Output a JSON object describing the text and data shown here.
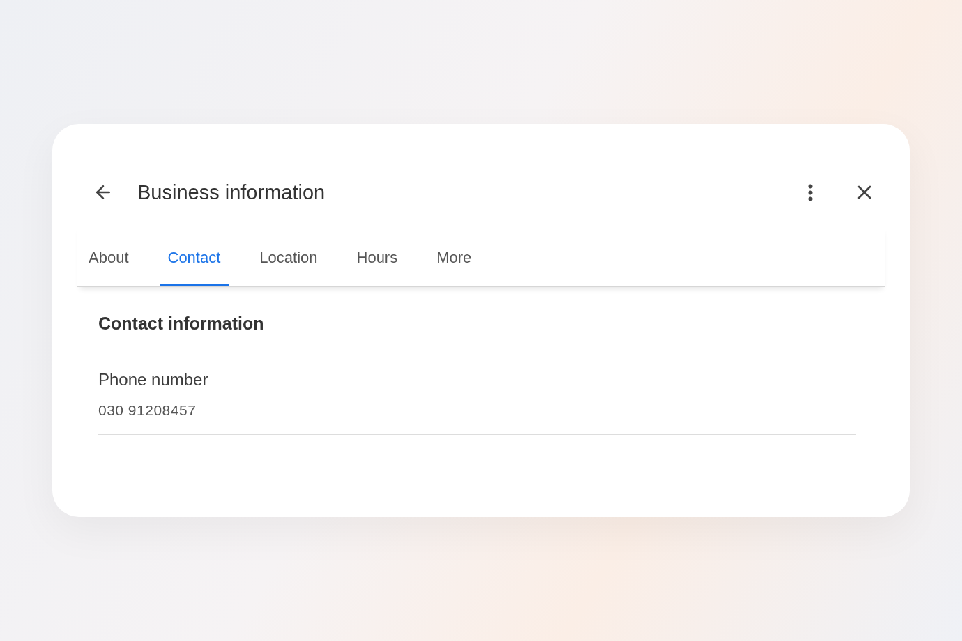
{
  "header": {
    "title": "Business information"
  },
  "tabs": [
    {
      "label": "About",
      "selected": false
    },
    {
      "label": "Contact",
      "selected": true
    },
    {
      "label": "Location",
      "selected": false
    },
    {
      "label": "Hours",
      "selected": false
    },
    {
      "label": "More",
      "selected": false
    }
  ],
  "section": {
    "title": "Contact information",
    "fields": [
      {
        "label": "Phone number",
        "value": "030 91208457"
      }
    ]
  }
}
